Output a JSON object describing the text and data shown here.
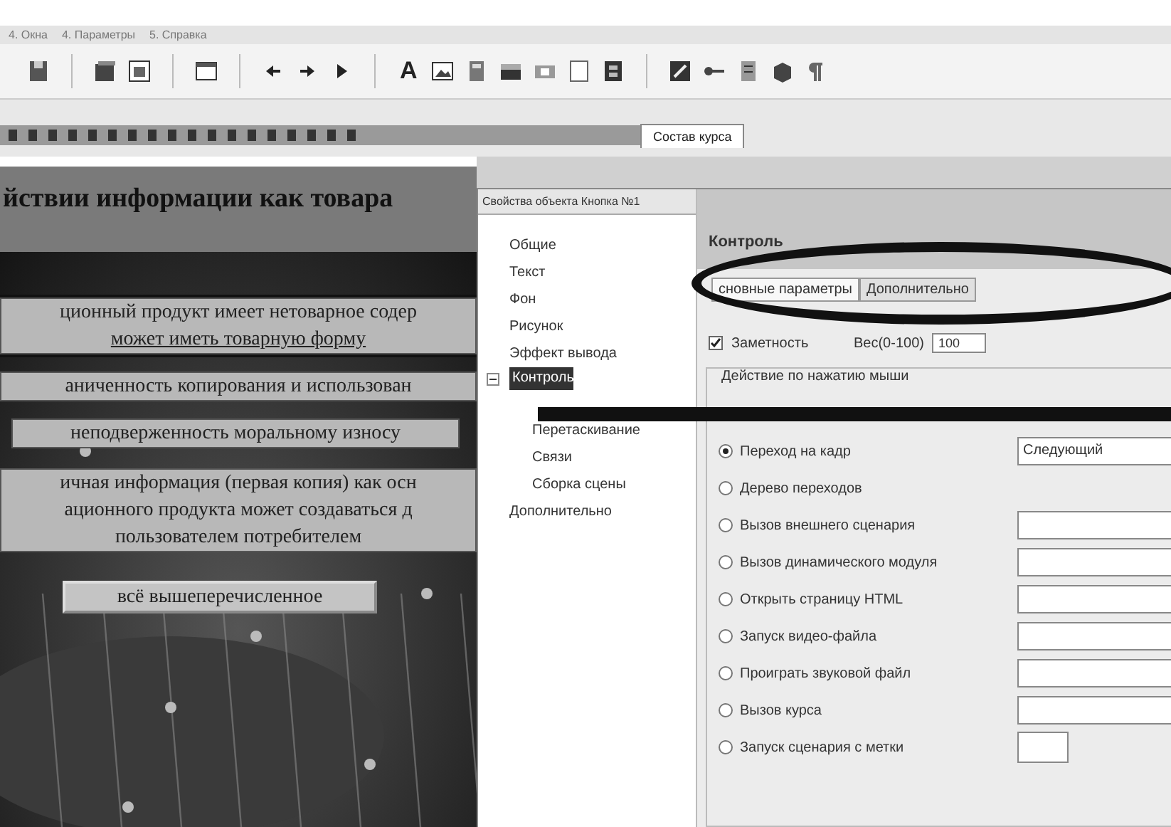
{
  "menu_bar": {
    "items": [
      "4. Окна",
      "4. Параметры",
      "5. Справка"
    ]
  },
  "toolbar": {
    "text_tool": "A"
  },
  "document_tabs": [
    {
      "label": "Состав курса",
      "selected": true
    }
  ],
  "slide": {
    "title": "йствии информации как товара",
    "options": [
      {
        "kind": "bar",
        "lines": [
          "ционный продукт имеет нетоварное содер",
          "может иметь товарную форму"
        ],
        "selected": true
      },
      {
        "kind": "bar",
        "lines": [
          "аниченность копирования и использован"
        ],
        "selected": false
      },
      {
        "kind": "box",
        "lines": [
          "неподверженность моральному износу"
        ],
        "selected": false
      },
      {
        "kind": "bar",
        "lines": [
          "ичная информация (первая копия) как осн",
          "ационного продукта может создаваться д",
          "пользователем потребителем"
        ],
        "selected": false
      },
      {
        "kind": "button",
        "lines": [
          "всё вышеперечисленное"
        ],
        "selected": false
      }
    ]
  },
  "dialog": {
    "title": "Свойства объекта Кнопка №1",
    "tree": [
      {
        "label": "Общие",
        "selected": false
      },
      {
        "label": "Текст",
        "selected": false
      },
      {
        "label": "Фон",
        "selected": false
      },
      {
        "label": "Рисунок",
        "selected": false
      },
      {
        "label": "Эффект вывода",
        "selected": false
      },
      {
        "label": "Контроль",
        "selected": true,
        "expanded": true,
        "children": [
          {
            "label": "Перетаскивание",
            "selected": false
          },
          {
            "label": "Связи",
            "selected": false
          },
          {
            "label": "Сборка сцены",
            "selected": false
          }
        ]
      },
      {
        "label": "Дополнительно",
        "selected": false
      }
    ],
    "section_title": "Контроль",
    "tabs": [
      {
        "label": "сновные параметры",
        "selected": true
      },
      {
        "label": "Дополнительно",
        "selected": false
      }
    ],
    "visibility": {
      "label": "Заметность",
      "checked": true
    },
    "weight": {
      "label": "Вес(0-100)",
      "value": "100"
    },
    "group_title": "Действие по нажатию мыши",
    "actions": [
      {
        "label": "Переход на кадр",
        "selected": true,
        "kind": "wide_field",
        "value": "Следующий"
      },
      {
        "label": "Дерево переходов",
        "selected": false,
        "kind": "plain"
      },
      {
        "label": "Вызов внешнего сценария",
        "selected": false,
        "kind": "wide_field"
      },
      {
        "label": "Вызов динамического модуля",
        "selected": false,
        "kind": "wide_field"
      },
      {
        "label": "Открыть страницу HTML",
        "selected": false,
        "kind": "wide_field"
      },
      {
        "label": "Запуск видео-файла",
        "selected": false,
        "kind": "wide_field"
      },
      {
        "label": "Проиграть звуковой файл",
        "selected": false,
        "kind": "wide_field"
      },
      {
        "label": "Вызов курса",
        "selected": false,
        "kind": "wide_field"
      },
      {
        "label": "Запуск сценария с метки",
        "selected": false,
        "kind": "small_field"
      }
    ]
  }
}
